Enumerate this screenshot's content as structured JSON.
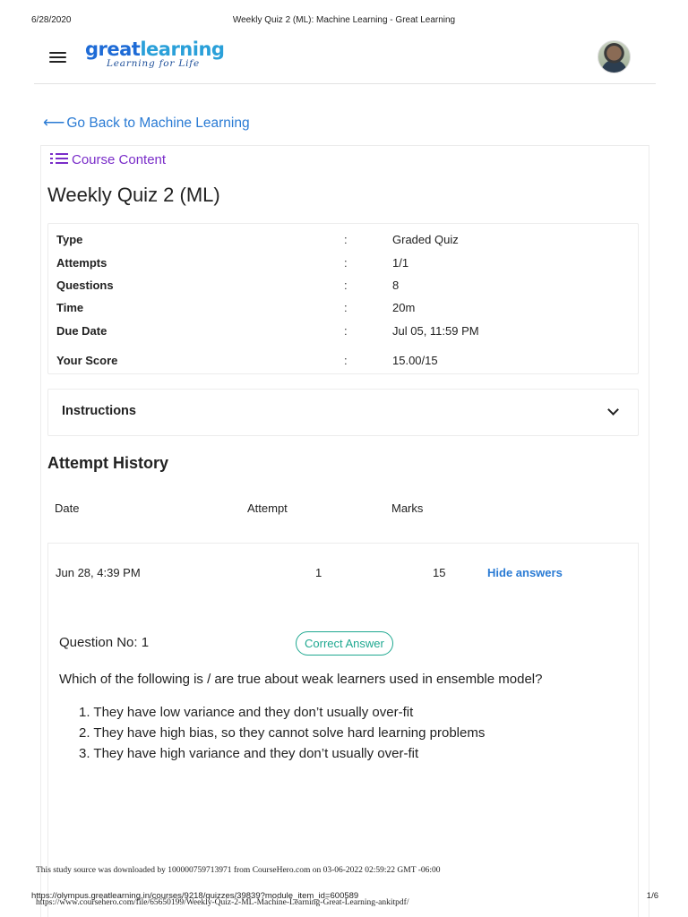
{
  "print_header": {
    "date": "6/28/2020",
    "title": "Weekly Quiz 2 (ML): Machine Learning - Great Learning"
  },
  "header": {
    "logo_main_a": "great",
    "logo_main_b": "learning",
    "logo_tagline": "Learning for Life",
    "menu_icon": "hamburger-icon",
    "avatar_icon": "user-avatar"
  },
  "nav": {
    "back_label": "Go Back to Machine Learning",
    "course_content_label": "Course Content"
  },
  "quiz": {
    "title": "Weekly Quiz 2 (ML)",
    "info": [
      {
        "key": "Type",
        "value": "Graded Quiz"
      },
      {
        "key": "Attempts",
        "value": "1/1"
      },
      {
        "key": "Questions",
        "value": "8"
      },
      {
        "key": "Time",
        "value": "20m"
      },
      {
        "key": "Due Date",
        "value": "Jul 05, 11:59 PM"
      },
      {
        "key": "Your Score",
        "value": "15.00/15"
      }
    ],
    "separator": ":",
    "instructions_label": "Instructions"
  },
  "history": {
    "title": "Attempt History",
    "columns": {
      "date": "Date",
      "attempt": "Attempt",
      "marks": "Marks"
    },
    "rows": [
      {
        "date": "Jun 28, 4:39 PM",
        "attempt": "1",
        "marks": "15",
        "action": "Hide answers"
      }
    ]
  },
  "question": {
    "number_label": "Question No: 1",
    "status": "Correct Answer",
    "text": "Which of the following is / are true about weak learners used in ensemble model?",
    "statements": [
      "1. They have low variance and they don’t usually over-fit",
      "2. They have high bias, so they cannot solve hard learning problems",
      "3. They have high variance and they don’t usually over-fit"
    ]
  },
  "footer": {
    "download_note": "This study source was downloaded by 100000759713971 from CourseHero.com on 03-06-2022 02:59:22 GMT -06:00",
    "url": "https://olympus.greatlearning.in/courses/9218/quizzes/39839?module_item_id=600589",
    "page": "1/6",
    "coursehero_url": "https://www.coursehero.com/file/65650199/Weekly-Quiz-2-ML-Machine-Learning-Great-Learning-ankitpdf/"
  },
  "colors": {
    "link": "#2a7bd4",
    "course_content": "#7a2dc9",
    "correct": "#1ea890",
    "logo": "#1e6bd6"
  }
}
